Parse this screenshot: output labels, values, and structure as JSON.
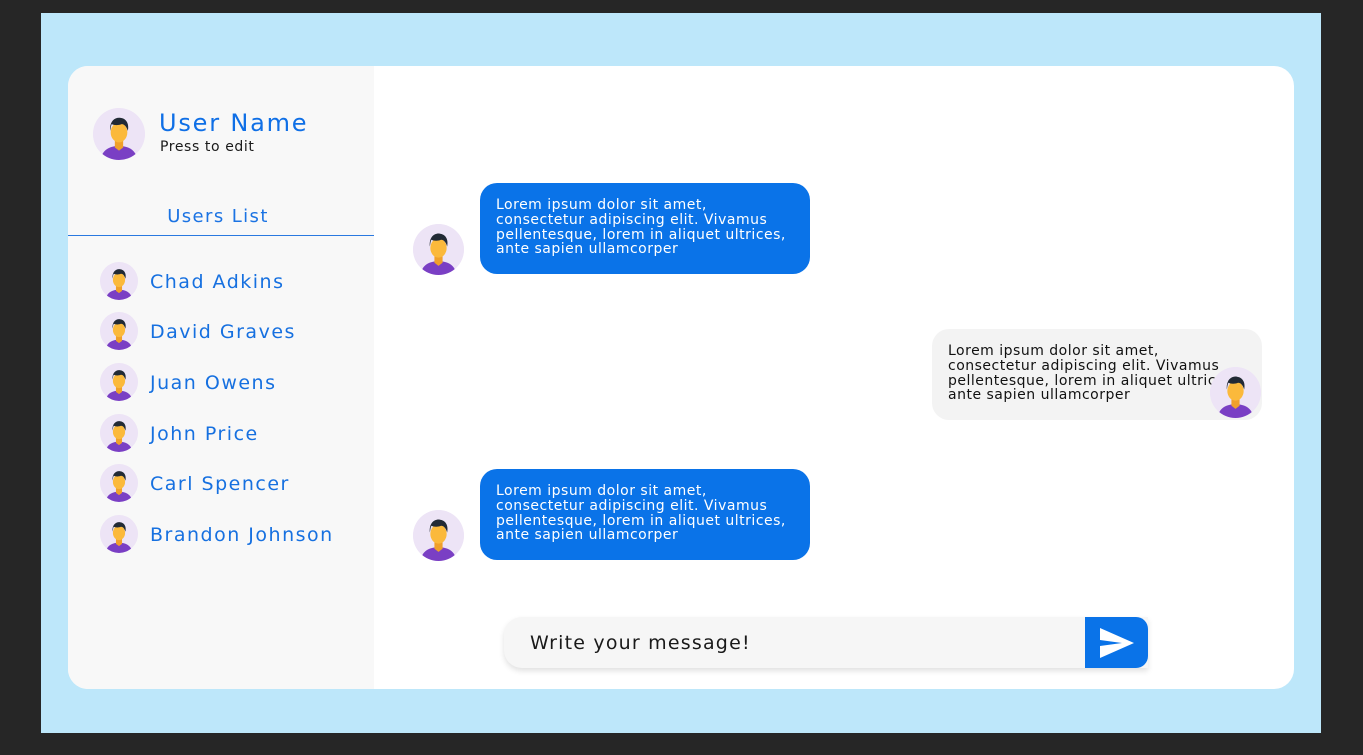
{
  "profile": {
    "name": "User Name",
    "subtitle": "Press to edit"
  },
  "users": {
    "title": "Users List",
    "items": [
      {
        "name": "Chad Adkins"
      },
      {
        "name": "David Graves"
      },
      {
        "name": "Juan Owens"
      },
      {
        "name": "John Price"
      },
      {
        "name": "Carl Spencer"
      },
      {
        "name": "Brandon Johnson"
      }
    ]
  },
  "messages": [
    {
      "direction": "incoming",
      "text": "Lorem ipsum dolor sit amet, consectetur adipiscing elit. Vivamus pellentesque, lorem in aliquet ultrices, ante sapien ullamcorper"
    },
    {
      "direction": "outgoing",
      "text": "Lorem ipsum dolor sit amet, consectetur adipiscing elit. Vivamus pellentesque, lorem in aliquet ultrices, ante sapien ullamcorper"
    },
    {
      "direction": "incoming",
      "text": "Lorem ipsum dolor sit amet, consectetur adipiscing elit. Vivamus pellentesque, lorem in aliquet ultrices, ante sapien ullamcorper"
    }
  ],
  "composer": {
    "placeholder": "Write your message!",
    "send_icon": "send-icon"
  },
  "colors": {
    "accent": "#0a73e8",
    "page_background": "#bde7fa",
    "sidebar_background": "#f8f8f8",
    "outgoing_bubble": "#f3f3f3"
  }
}
